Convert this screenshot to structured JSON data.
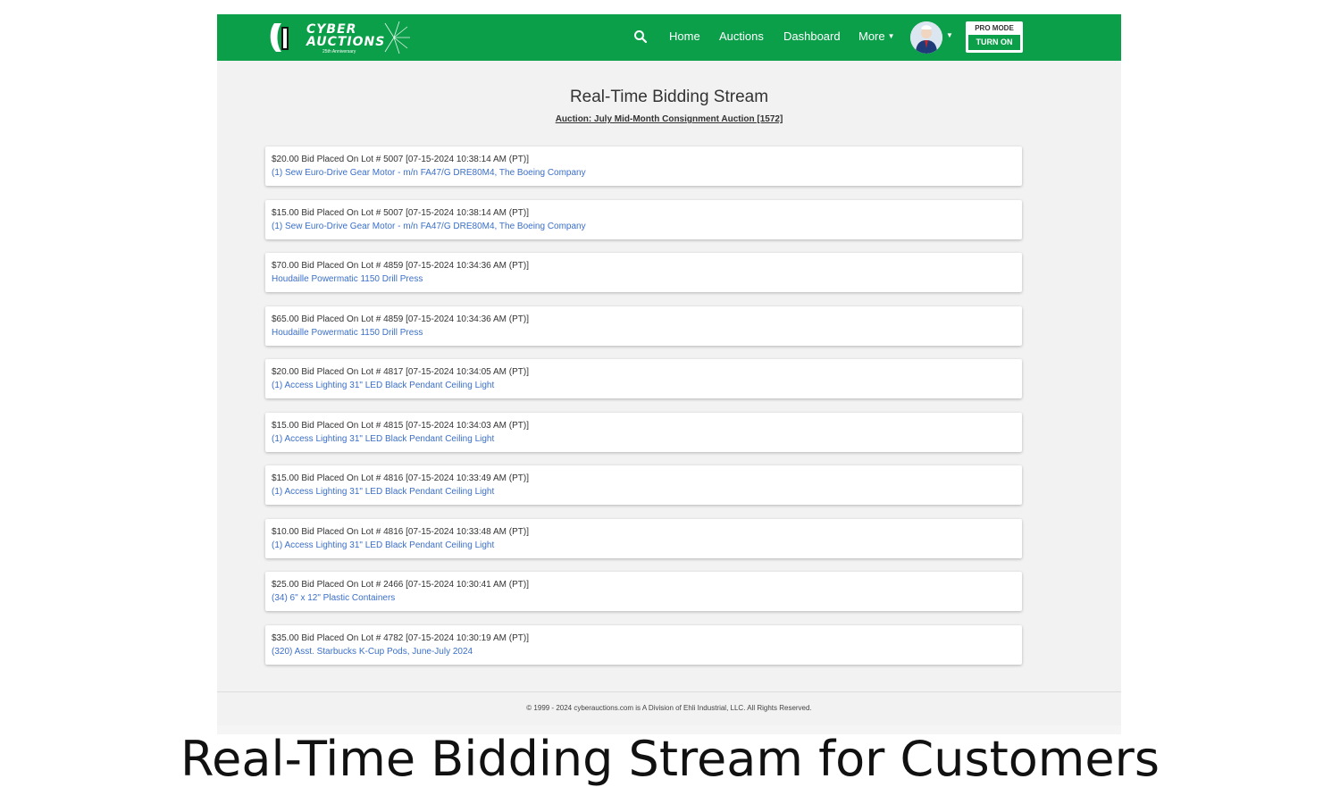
{
  "navbar": {
    "logo_line1": "CYBER",
    "logo_line2": "AUCTIONS",
    "logo_sub": "25th Anniversary",
    "search_icon": "search-icon",
    "home": "Home",
    "auctions": "Auctions",
    "dashboard": "Dashboard",
    "more": "More",
    "pro_mode_label": "PRO MODE",
    "pro_mode_button": "TURN ON",
    "brand_color": "#0c9f4a"
  },
  "page": {
    "title": "Real-Time Bidding Stream",
    "auction": "Auction: July Mid-Month Consignment Auction [1572]"
  },
  "bids": [
    {
      "text": "$20.00 Bid Placed On Lot # 5007 [07-15-2024 10:38:14 AM (PT)]",
      "item": "(1) Sew Euro-Drive Gear Motor - m/n FA47/G DRE80M4, The Boeing Company"
    },
    {
      "text": "$15.00 Bid Placed On Lot # 5007 [07-15-2024 10:38:14 AM (PT)]",
      "item": "(1) Sew Euro-Drive Gear Motor - m/n FA47/G DRE80M4, The Boeing Company"
    },
    {
      "text": "$70.00 Bid Placed On Lot # 4859 [07-15-2024 10:34:36 AM (PT)]",
      "item": "Houdaille Powermatic 1150 Drill Press"
    },
    {
      "text": "$65.00 Bid Placed On Lot # 4859 [07-15-2024 10:34:36 AM (PT)]",
      "item": "Houdaille Powermatic 1150 Drill Press"
    },
    {
      "text": "$20.00 Bid Placed On Lot # 4817 [07-15-2024 10:34:05 AM (PT)]",
      "item": "(1) Access Lighting 31\" LED Black Pendant Ceiling Light"
    },
    {
      "text": "$15.00 Bid Placed On Lot # 4815 [07-15-2024 10:34:03 AM (PT)]",
      "item": "(1) Access Lighting 31\" LED Black Pendant Ceiling Light"
    },
    {
      "text": "$15.00 Bid Placed On Lot # 4816 [07-15-2024 10:33:49 AM (PT)]",
      "item": "(1) Access Lighting 31\" LED Black Pendant Ceiling Light"
    },
    {
      "text": "$10.00 Bid Placed On Lot # 4816 [07-15-2024 10:33:48 AM (PT)]",
      "item": "(1) Access Lighting 31\" LED Black Pendant Ceiling Light"
    },
    {
      "text": "$25.00 Bid Placed On Lot # 2466 [07-15-2024 10:30:41 AM (PT)]",
      "item": "(34) 6\" x 12\" Plastic Containers"
    },
    {
      "text": "$35.00 Bid Placed On Lot # 4782 [07-15-2024 10:30:19 AM (PT)]",
      "item": "(320) Asst. Starbucks K-Cup Pods, June-July 2024"
    }
  ],
  "footer": "© 1999 - 2024 cyberauctions.com is A Division of Ehli Industrial, LLC. All Rights Reserved.",
  "caption": "Real-Time Bidding Stream for Customers"
}
